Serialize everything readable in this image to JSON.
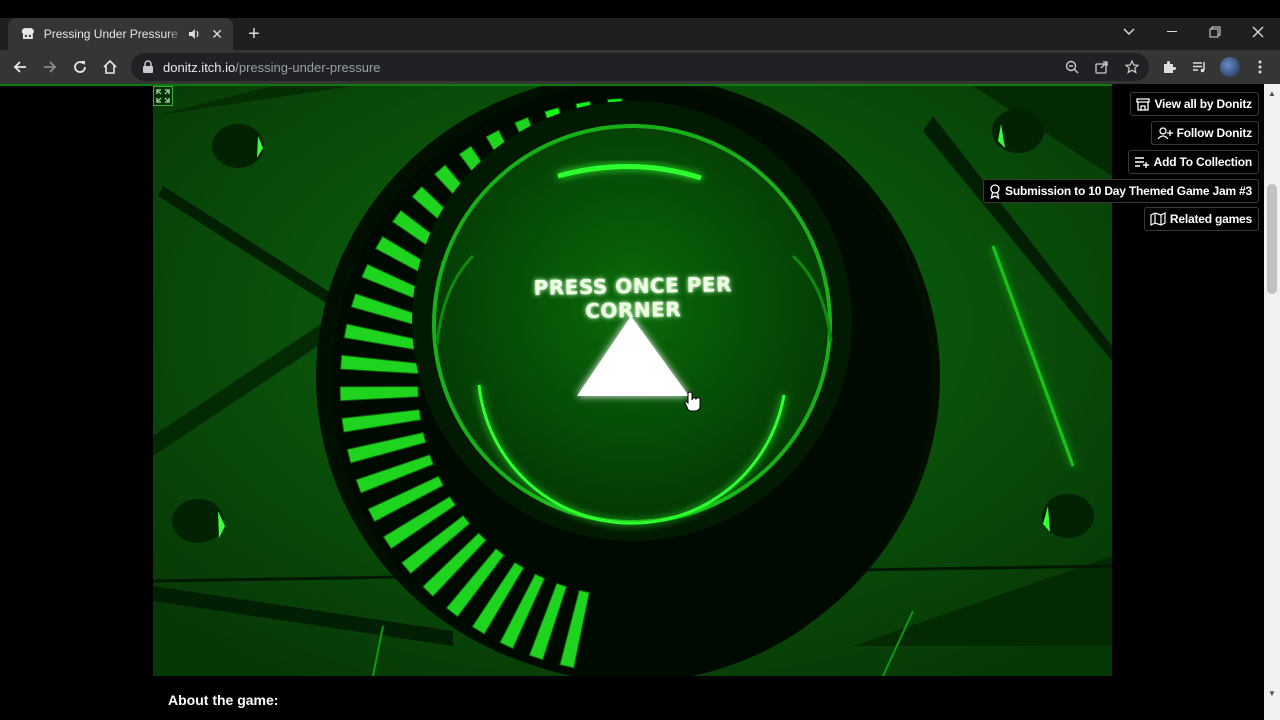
{
  "browser": {
    "tab_title": "Pressing Under Pressure by Donitz",
    "tab_close": "✕",
    "new_tab": "+",
    "url_host": "donitz.itch.io",
    "url_path": "/pressing-under-pressure",
    "icons": [
      "back-icon",
      "forward-icon",
      "reload-icon",
      "home-icon",
      "lock-icon",
      "zoom-icon",
      "share-icon",
      "bookmark-star-icon",
      "extensions-icon",
      "media-icon",
      "profile-avatar",
      "menu-icon"
    ]
  },
  "game": {
    "instruction": "PRESS ONCE PER CORNER",
    "colors": {
      "accent": "#00ff00",
      "background": "#0b4d0b",
      "segment": "#19d619"
    }
  },
  "user_tools": {
    "view_all": "View all by Donitz",
    "follow": "Follow Donitz",
    "add_collection": "Add To Collection",
    "submission": "Submission to 10 Day Themed Game Jam #3",
    "related": "Related games"
  },
  "page": {
    "about_heading": "About the game:"
  }
}
